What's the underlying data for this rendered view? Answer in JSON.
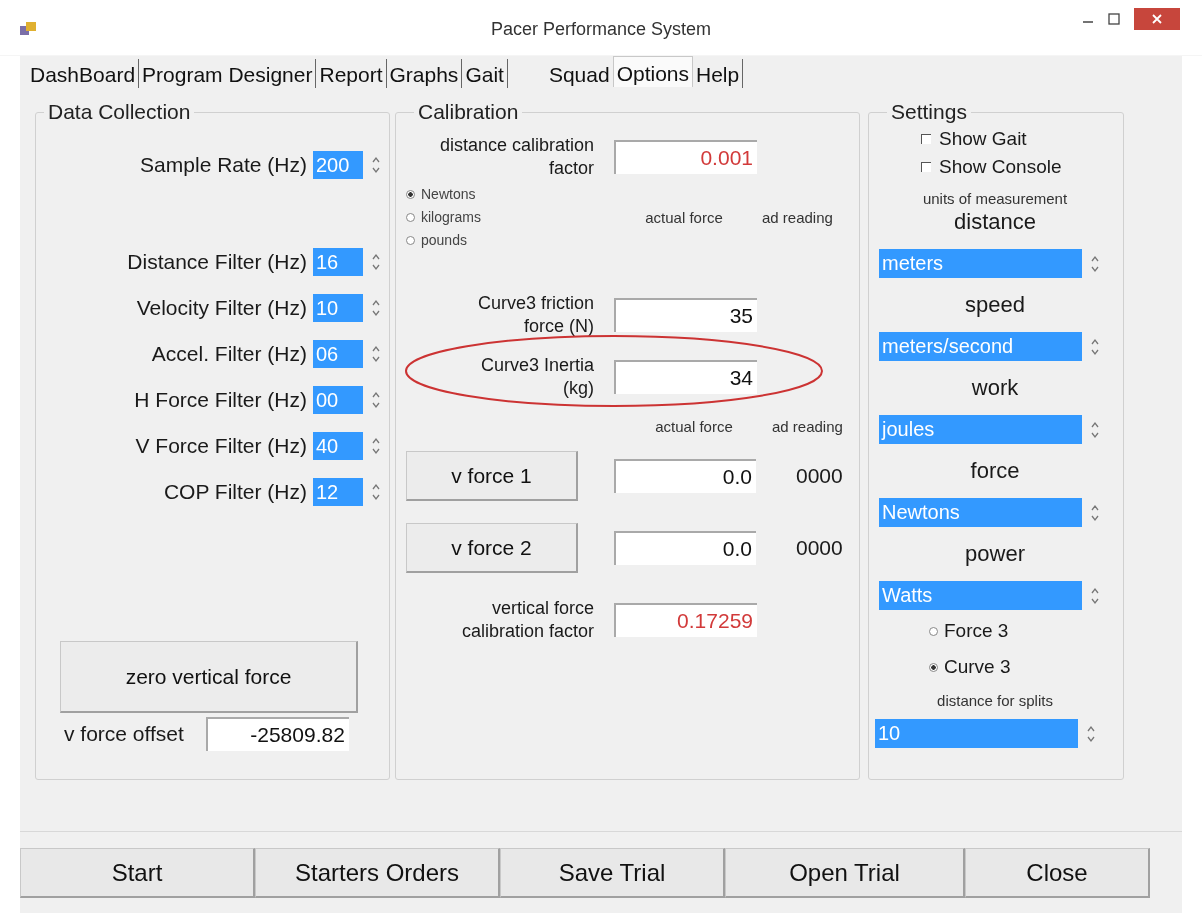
{
  "window": {
    "title": "Pacer Performance System"
  },
  "tabs": [
    {
      "label": "DashBoard",
      "selected": false
    },
    {
      "label": "Program Designer",
      "selected": false
    },
    {
      "label": "Report",
      "selected": false
    },
    {
      "label": "Graphs",
      "selected": false
    },
    {
      "label": "Gait",
      "selected": false
    },
    {
      "label": "Squad",
      "selected": false
    },
    {
      "label": "Options",
      "selected": true
    },
    {
      "label": "Help",
      "selected": false
    }
  ],
  "data_collection": {
    "title": "Data Collection",
    "filters": [
      {
        "label": "Sample Rate (Hz)",
        "value": "200"
      },
      {
        "label": "Distance Filter (Hz)",
        "value": "16"
      },
      {
        "label": "Velocity Filter (Hz)",
        "value": "10"
      },
      {
        "label": "Accel. Filter (Hz)",
        "value": "06"
      },
      {
        "label": "H Force Filter (Hz)",
        "value": "00"
      },
      {
        "label": "V Force Filter (Hz)",
        "value": "40"
      },
      {
        "label": "COP Filter (Hz)",
        "value": "12"
      }
    ],
    "zero_button": "zero vertical force",
    "offset": {
      "label": "v force offset",
      "value": "-25809.82"
    }
  },
  "calibration": {
    "title": "Calibration",
    "distance_factor": {
      "label": "distance calibration factor",
      "value": "0.001"
    },
    "units": [
      {
        "label": "Newtons",
        "selected": true
      },
      {
        "label": "kilograms",
        "selected": false
      },
      {
        "label": "pounds",
        "selected": false
      }
    ],
    "headers_top": [
      "actual force",
      "ad reading"
    ],
    "friction": {
      "label": "Curve3 friction force (N)",
      "value": "35"
    },
    "inertia": {
      "label": "Curve3 Inertia (kg)",
      "value": "34",
      "circled": true
    },
    "headers_bottom": [
      "actual force",
      "ad reading"
    ],
    "force_rows": [
      {
        "button": "v force 1",
        "value": "0.0",
        "reading": "0000"
      },
      {
        "button": "v force 2",
        "value": "0.0",
        "reading": "0000"
      }
    ],
    "vertical_factor": {
      "label": "vertical force calibration factor",
      "value": "0.17259"
    }
  },
  "settings": {
    "title": "Settings",
    "checkboxes": [
      {
        "label": "Show Gait",
        "checked": false
      },
      {
        "label": "Show Console",
        "checked": false
      }
    ],
    "units_heading": "units of measurement",
    "selectors": [
      {
        "label": "distance",
        "value": "meters"
      },
      {
        "label": "speed",
        "value": "meters/second"
      },
      {
        "label": "work",
        "value": "joules"
      },
      {
        "label": "force",
        "value": "Newtons"
      },
      {
        "label": "power",
        "value": "Watts"
      }
    ],
    "modes": [
      {
        "label": "Force 3",
        "selected": false
      },
      {
        "label": "Curve 3",
        "selected": true
      }
    ],
    "splits": {
      "label": "distance for splits",
      "value": "10"
    }
  },
  "buttons": [
    "Start",
    "Starters Orders",
    "Save Trial",
    "Open Trial",
    "Close"
  ]
}
